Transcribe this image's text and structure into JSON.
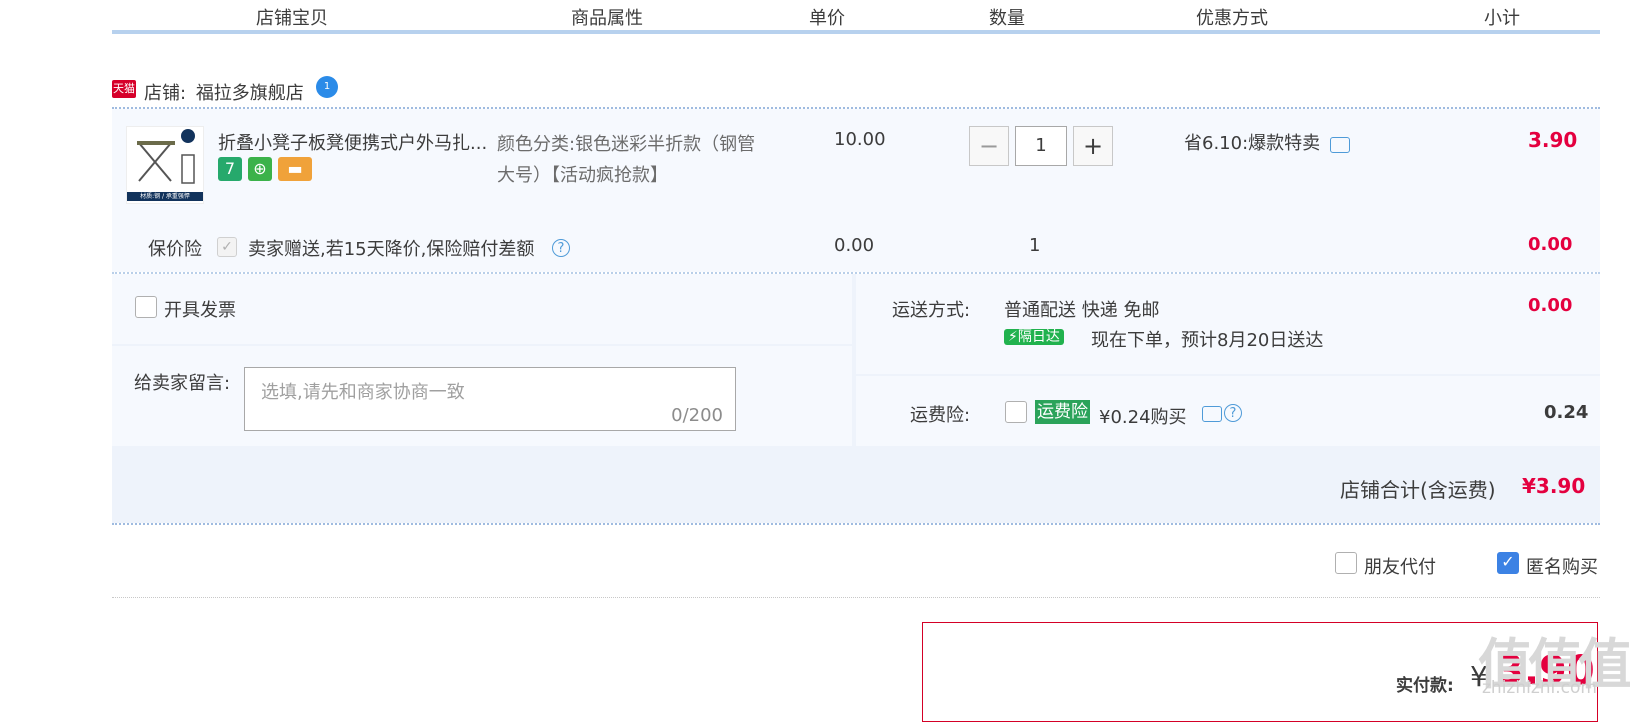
{
  "header": {
    "columns": [
      "店铺宝贝",
      "商品属性",
      "单价",
      "数量",
      "优惠方式",
      "小计"
    ]
  },
  "shop": {
    "badge": "天猫",
    "label": "店铺:",
    "name": "福拉多旗舰店",
    "chat_badge": "1"
  },
  "item": {
    "title": "折叠小凳子板凳便携式户外马扎...",
    "thumb_caption": "材质:钢 / 承重强悍",
    "badges": [
      {
        "text": "7",
        "color": "#26a96c"
      },
      {
        "text": "⊕",
        "color": "#3bb24a"
      },
      {
        "text": "▬",
        "color": "#f0a23a"
      }
    ],
    "attr_line1": "颜色分类:银色迷彩半折款（钢管",
    "attr_line2": "大号）【活动疯抢款】",
    "price": "10.00",
    "qty_minus": "−",
    "qty": "1",
    "qty_plus": "+",
    "promo": "省6.10:爆款特卖",
    "subtotal": "3.90"
  },
  "insurance": {
    "label": "保价险",
    "check": "✓",
    "desc": "卖家赠送,若15天降价,保险赔付差额",
    "help": "?",
    "price": "0.00",
    "qty": "1",
    "subtotal": "0.00"
  },
  "invoice": {
    "label": "开具发票"
  },
  "message": {
    "label": "给卖家留言:",
    "placeholder": "选填,请先和商家协商一致",
    "counter": "0/200"
  },
  "shipping": {
    "label": "运送方式:",
    "method": "普通配送 快递 免邮",
    "next_day_tag": "隔日达",
    "estimate": "现在下单，预计8月20日送达",
    "fee": "0.00"
  },
  "freight_insurance": {
    "label": "运费险:",
    "tag": "运费险",
    "price_text": "¥0.24购买",
    "help": "?",
    "fee": "0.24"
  },
  "shop_total": {
    "label": "店铺合计(含运费)",
    "value": "¥3.90"
  },
  "options": {
    "friend_pay": "朋友代付",
    "anonymous": "匿名购买",
    "anonymous_check": "✓"
  },
  "payment": {
    "label": "实付款:",
    "currency": "¥",
    "amount": "3.90"
  },
  "watermark": {
    "logo": "值值值",
    "url": "zhizhizhi.com"
  },
  "colors": {
    "accent_red": "#e4003f",
    "header_line": "#b7d1ee",
    "check_blue": "#3c82e4"
  }
}
